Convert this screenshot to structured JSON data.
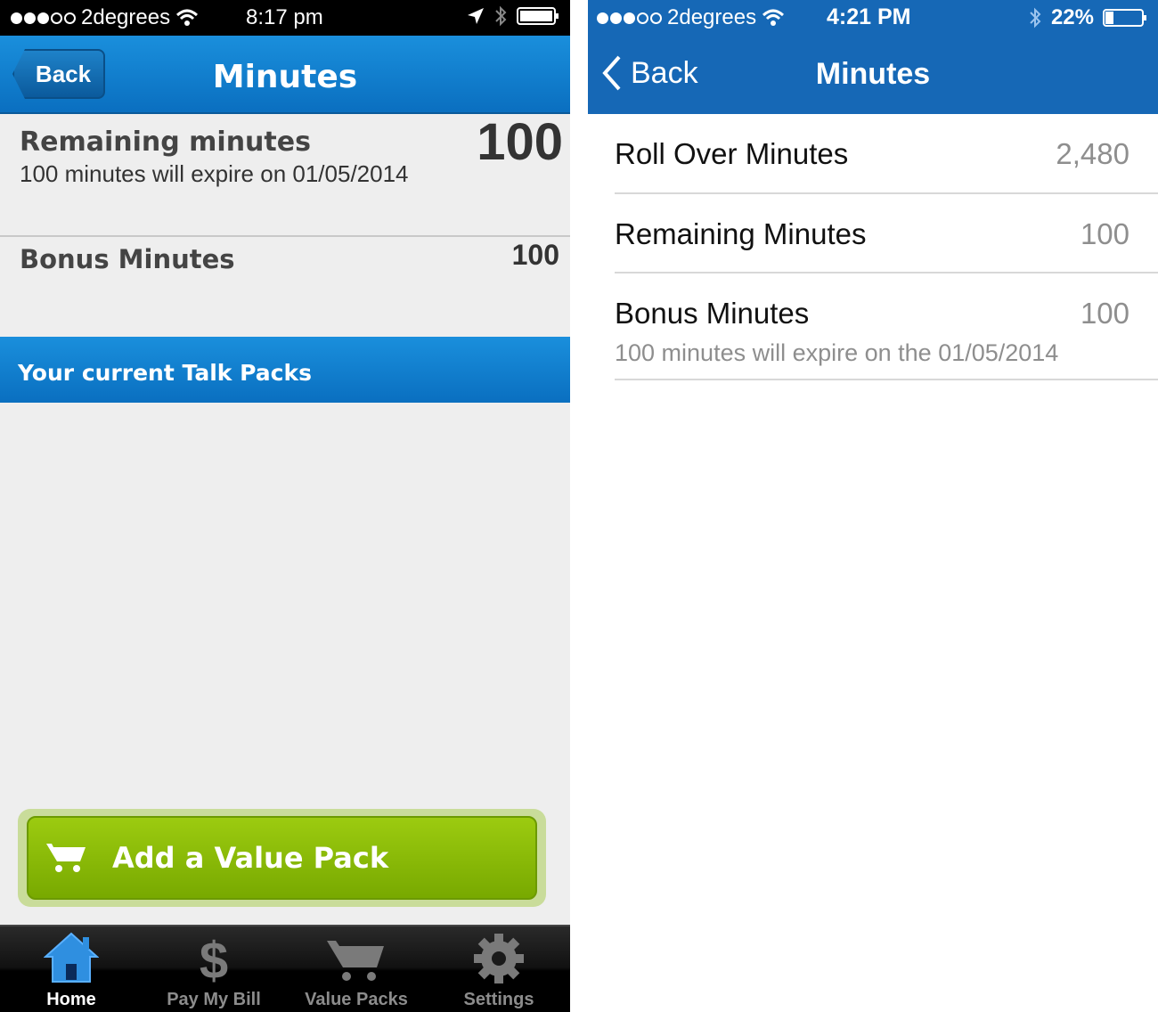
{
  "left_screen": {
    "status_bar": {
      "carrier": "2degrees",
      "time": "8:17 pm"
    },
    "nav": {
      "back_label": "Back",
      "title": "Minutes"
    },
    "remaining": {
      "label": "Remaining minutes",
      "value": "100",
      "note": "100 minutes will expire on 01/05/2014"
    },
    "bonus": {
      "label": "Bonus Minutes",
      "value": "100"
    },
    "section_header": "Your current Talk Packs",
    "add_button_label": "Add a Value Pack",
    "tab_bar": {
      "items": [
        {
          "label": "Home",
          "icon": "home-icon",
          "active": true
        },
        {
          "label": "Pay My Bill",
          "icon": "dollar-icon",
          "active": false
        },
        {
          "label": "Value Packs",
          "icon": "cart-icon",
          "active": false
        },
        {
          "label": "Settings",
          "icon": "gear-icon",
          "active": false
        }
      ]
    },
    "colors": {
      "nav_blue": "#0a6fc0",
      "button_green": "#8bbd06",
      "background": "#eeeeee"
    }
  },
  "right_screen": {
    "status_bar": {
      "carrier": "2degrees",
      "time": "4:21 PM",
      "battery": "22%"
    },
    "nav": {
      "back_label": "Back",
      "title": "Minutes"
    },
    "rows": [
      {
        "label": "Roll Over Minutes",
        "value": "2,480"
      },
      {
        "label": "Remaining Minutes",
        "value": "100"
      },
      {
        "label": "Bonus Minutes",
        "value": "100",
        "note": "100 minutes will expire on the 01/05/2014"
      }
    ],
    "colors": {
      "header_blue": "#1668b6",
      "value_gray": "#8e8e8e"
    }
  }
}
